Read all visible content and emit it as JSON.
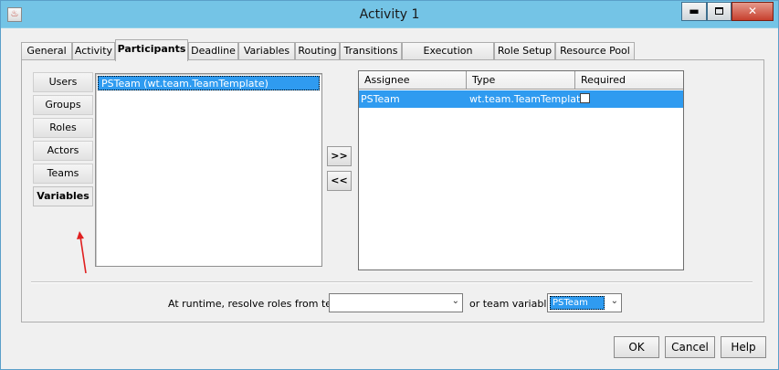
{
  "window": {
    "title": "Activity 1",
    "icon": "java-cup-icon",
    "controls": [
      "minimize",
      "maximize",
      "close"
    ]
  },
  "tabs": [
    "General",
    "Activity",
    "Participants",
    "Deadline",
    "Variables",
    "Routing",
    "Transitions",
    "Execution Options",
    "Role Setup",
    "Resource Pool"
  ],
  "active_tab": "Participants",
  "participant_types": [
    "Users",
    "Groups",
    "Roles",
    "Actors",
    "Teams",
    "Variables"
  ],
  "active_participant_type": "Variables",
  "available_list": [
    "PSTeam (wt.team.TeamTemplate)"
  ],
  "move_buttons": {
    "add": ">>",
    "remove": "<<"
  },
  "assignees_table": {
    "columns": [
      "Assignee",
      "Type",
      "Required"
    ],
    "rows": [
      {
        "assignee": "PSTeam",
        "type": "wt.team.TeamTemplate",
        "required": false
      }
    ]
  },
  "resolve": {
    "label": "At runtime, resolve roles from team",
    "team_value": "",
    "or_label": "or team variable",
    "team_variable_value": "PSTeam"
  },
  "buttons": {
    "ok": "OK",
    "cancel": "Cancel",
    "help": "Help"
  },
  "colors": {
    "titlebar": "#74c4e6",
    "selection": "#2f9bf0",
    "annotation_arrow": "#e02020"
  }
}
